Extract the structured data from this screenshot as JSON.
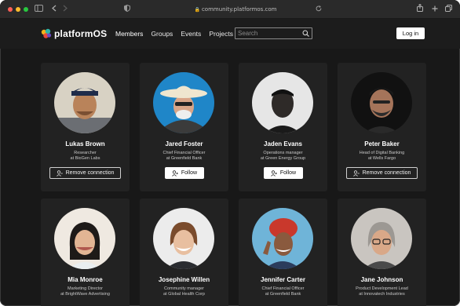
{
  "browser": {
    "url": "community.platformos.com",
    "lock_icon": "lock-icon"
  },
  "nav": {
    "logo_text": "platformOS",
    "menu": [
      "Members",
      "Groups",
      "Events",
      "Projects"
    ],
    "search_placeholder": "Search",
    "login_label": "Log in"
  },
  "members": [
    {
      "name": "Lukas Brown",
      "title": "Researcher",
      "org": "at BioGen Labs",
      "action": "Remove connection",
      "style": "outline",
      "color": "#d8d2c4"
    },
    {
      "name": "Jared Foster",
      "title": "Chief Financial Officer",
      "org": "at Greenfield Bank",
      "action": "Follow",
      "style": "solid",
      "color": "#1f86c8"
    },
    {
      "name": "Jaden Evans",
      "title": "Operations manager",
      "org": "at Green Energy Group",
      "action": "Follow",
      "style": "solid",
      "color": "#e6e6e6"
    },
    {
      "name": "Peter Baker",
      "title": "Head of Digital Banking",
      "org": "at Wells Fargo",
      "action": "Remove connection",
      "style": "outline",
      "color": "#111111"
    },
    {
      "name": "Mia Monroe",
      "title": "Marketing Director",
      "org": "at BrightWave Advertising",
      "action": "",
      "style": "",
      "color": "#efe9e1"
    },
    {
      "name": "Josephine Willen",
      "title": "Community manager",
      "org": "at Global Health Corp",
      "action": "",
      "style": "",
      "color": "#ececec"
    },
    {
      "name": "Jennifer Carter",
      "title": "Chief Financial Officer",
      "org": "at Greenfield Bank",
      "action": "",
      "style": "",
      "color": "#6fb4d8"
    },
    {
      "name": "Jane Johnson",
      "title": "Product Development Lead",
      "org": "at Innovatech Industries",
      "action": "",
      "style": "",
      "color": "#c9c5c0"
    }
  ]
}
